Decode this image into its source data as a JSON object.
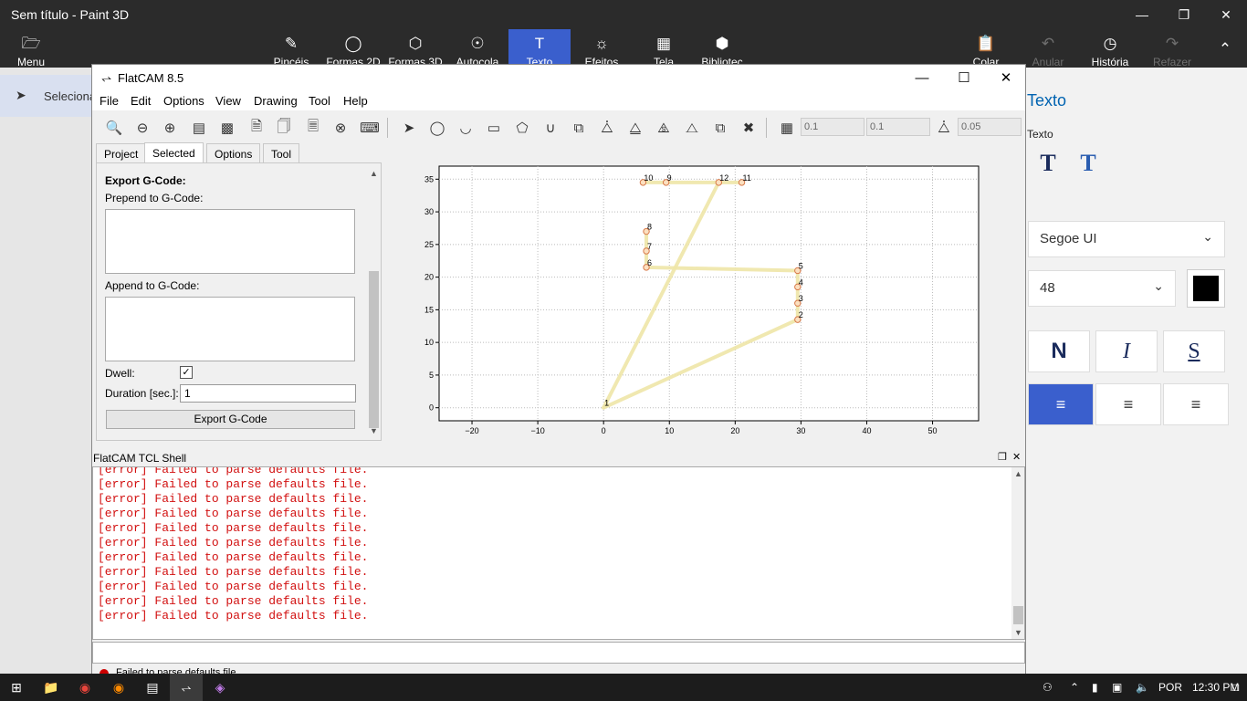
{
  "paint3d": {
    "title": "Sem título - Paint 3D",
    "ribbon": {
      "menu": "Menu",
      "tools": [
        {
          "label": "Pincéis",
          "icon": "brush-icon"
        },
        {
          "label": "Formas 2D",
          "icon": "shapes-2d-icon"
        },
        {
          "label": "Formas 3D",
          "icon": "shapes-3d-icon"
        },
        {
          "label": "Autocola",
          "icon": "stickers-icon"
        },
        {
          "label": "Texto",
          "icon": "text-icon"
        },
        {
          "label": "Efeitos",
          "icon": "effects-icon"
        },
        {
          "label": "Tela",
          "icon": "canvas-icon"
        },
        {
          "label": "Bibliotec",
          "icon": "library-icon"
        }
      ],
      "colar": "Colar",
      "anular": "Anular",
      "historia": "História",
      "refazer": "Refazer"
    },
    "select_label": "Seleciona",
    "right_panel": {
      "title": "Texto",
      "subtitle": "Texto",
      "font": "Segoe UI",
      "size": "48",
      "color": "#000000",
      "styles": [
        "N",
        "I",
        "S"
      ]
    }
  },
  "flatcam": {
    "title": "FlatCAM 8.5",
    "menu": [
      "File",
      "Edit",
      "Options",
      "View",
      "Drawing",
      "Tool",
      "Help"
    ],
    "toolbar_inputs": [
      "0.1",
      "0.1",
      "0.05"
    ],
    "tabs": [
      "Project",
      "Selected",
      "Options",
      "Tool"
    ],
    "panel": {
      "section_title": "Export G-Code:",
      "prepend_label": "Prepend to G-Code:",
      "append_label": "Append to G-Code:",
      "dwell_label": "Dwell:",
      "dwell_checked": true,
      "duration_label": "Duration [sec.]:",
      "duration_value": "1",
      "export_button": "Export G-Code"
    },
    "shell": {
      "title": "FlatCAM TCL Shell",
      "lines": [
        "[error] Failed to parse defaults file.",
        "[error] Failed to parse defaults file.",
        "[error] Failed to parse defaults file.",
        "[error] Failed to parse defaults file.",
        "[error] Failed to parse defaults file.",
        "[error] Failed to parse defaults file.",
        "[error] Failed to parse defaults file.",
        "[error] Failed to parse defaults file.",
        "[error] Failed to parse defaults file.",
        "[error] Failed to parse defaults file.",
        "[error] Failed to parse defaults file."
      ]
    },
    "status": "Failed to parse defaults file."
  },
  "chart_data": {
    "type": "line",
    "xlim": [
      -25,
      57
    ],
    "ylim": [
      -2,
      37
    ],
    "x_ticks": [
      -20,
      -10,
      0,
      10,
      20,
      30,
      40,
      50
    ],
    "y_ticks": [
      0,
      5,
      10,
      15,
      20,
      25,
      30,
      35
    ],
    "grid": true,
    "path": [
      {
        "label": "1",
        "x": 0,
        "y": 0
      },
      {
        "label": "2",
        "x": 29.5,
        "y": 13.5
      },
      {
        "label": "3",
        "x": 29.5,
        "y": 16
      },
      {
        "label": "4",
        "x": 29.5,
        "y": 18.5
      },
      {
        "label": "5",
        "x": 29.5,
        "y": 21
      },
      {
        "label": "6",
        "x": 6.5,
        "y": 21.5
      },
      {
        "label": "7",
        "x": 6.5,
        "y": 24
      },
      {
        "label": "8",
        "x": 6.5,
        "y": 27
      },
      {
        "label": "9",
        "x": 9.5,
        "y": 34.5
      },
      {
        "label": "10",
        "x": 6,
        "y": 34.5
      },
      {
        "label": "11",
        "x": 21,
        "y": 34.5
      },
      {
        "label": "12",
        "x": 17.5,
        "y": 34.5
      }
    ],
    "connections": [
      [
        1,
        2
      ],
      [
        2,
        3
      ],
      [
        3,
        4
      ],
      [
        4,
        5
      ],
      [
        5,
        6
      ],
      [
        6,
        7
      ],
      [
        7,
        8
      ],
      [
        1,
        12
      ],
      [
        10,
        9
      ],
      [
        9,
        12
      ],
      [
        12,
        11
      ]
    ]
  },
  "taskbar": {
    "language": "POR",
    "time": "12:30 PM"
  }
}
